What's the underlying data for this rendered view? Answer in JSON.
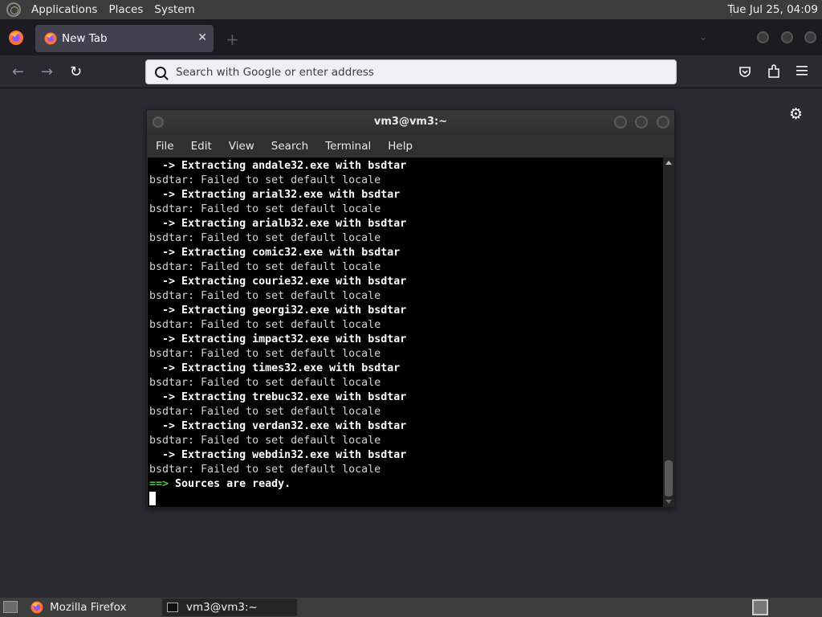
{
  "top_panel": {
    "menus": [
      "Applications",
      "Places",
      "System"
    ],
    "clock": "Tue Jul 25, 04:09"
  },
  "browser": {
    "tab": {
      "title": "New Tab"
    },
    "url_placeholder": "Search with Google or enter address"
  },
  "terminal": {
    "title": "vm3@vm3:~",
    "menu": [
      "File",
      "Edit",
      "View",
      "Search",
      "Terminal",
      "Help"
    ],
    "lines": [
      {
        "prefix": "  ->",
        "text": " Extracting andale32.exe with bsdtar",
        "style": "bold"
      },
      {
        "text": "bsdtar: Failed to set default locale",
        "style": "plain"
      },
      {
        "prefix": "  ->",
        "text": " Extracting arial32.exe with bsdtar",
        "style": "bold"
      },
      {
        "text": "bsdtar: Failed to set default locale",
        "style": "plain"
      },
      {
        "prefix": "  ->",
        "text": " Extracting arialb32.exe with bsdtar",
        "style": "bold"
      },
      {
        "text": "bsdtar: Failed to set default locale",
        "style": "plain"
      },
      {
        "prefix": "  ->",
        "text": " Extracting comic32.exe with bsdtar",
        "style": "bold"
      },
      {
        "text": "bsdtar: Failed to set default locale",
        "style": "plain"
      },
      {
        "prefix": "  ->",
        "text": " Extracting courie32.exe with bsdtar",
        "style": "bold"
      },
      {
        "text": "bsdtar: Failed to set default locale",
        "style": "plain"
      },
      {
        "prefix": "  ->",
        "text": " Extracting georgi32.exe with bsdtar",
        "style": "bold"
      },
      {
        "text": "bsdtar: Failed to set default locale",
        "style": "plain"
      },
      {
        "prefix": "  ->",
        "text": " Extracting impact32.exe with bsdtar",
        "style": "bold"
      },
      {
        "text": "bsdtar: Failed to set default locale",
        "style": "plain"
      },
      {
        "prefix": "  ->",
        "text": " Extracting times32.exe with bsdtar",
        "style": "bold"
      },
      {
        "text": "bsdtar: Failed to set default locale",
        "style": "plain"
      },
      {
        "prefix": "  ->",
        "text": " Extracting trebuc32.exe with bsdtar",
        "style": "bold"
      },
      {
        "text": "bsdtar: Failed to set default locale",
        "style": "plain"
      },
      {
        "prefix": "  ->",
        "text": " Extracting verdan32.exe with bsdtar",
        "style": "bold"
      },
      {
        "text": "bsdtar: Failed to set default locale",
        "style": "plain"
      },
      {
        "prefix": "  ->",
        "text": " Extracting webdin32.exe with bsdtar",
        "style": "bold"
      },
      {
        "text": "bsdtar: Failed to set default locale",
        "style": "plain"
      },
      {
        "prefix": "==>",
        "text": " Sources are ready.",
        "style": "green-prefix"
      }
    ]
  },
  "taskbar": {
    "items": [
      "Mozilla Firefox",
      "vm3@vm3:~"
    ]
  },
  "colors": {
    "terminal_bg": "#000000",
    "prompt_green": "#4ec94e",
    "firefox_toolbar": "#2b2a33"
  }
}
